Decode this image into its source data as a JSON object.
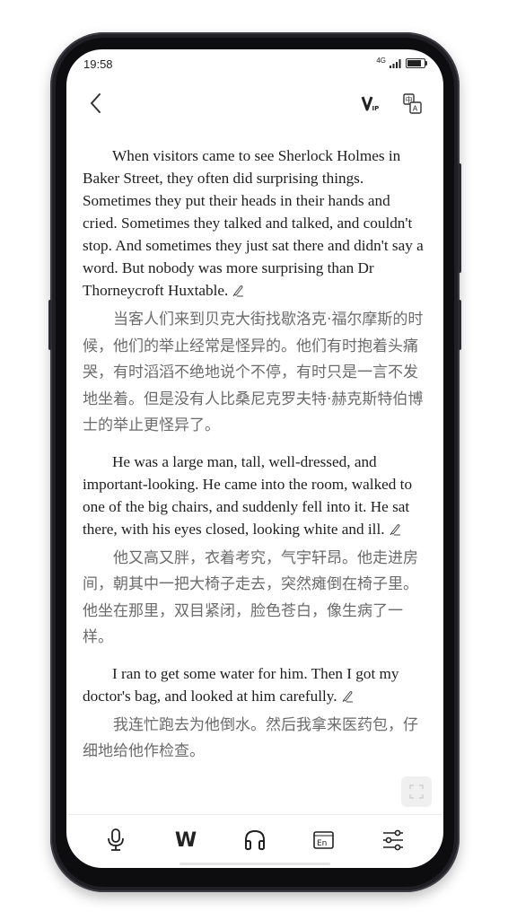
{
  "status_bar": {
    "time": "19:58",
    "network": "4G",
    "icons": [
      "signal-icon",
      "battery-icon"
    ]
  },
  "header": {
    "icons": [
      "back-chevron-icon",
      "vip-icon",
      "translate-icon"
    ]
  },
  "reader": {
    "blocks": [
      {
        "en": "When visitors came to see Sherlock Holmes in Baker Street, they often did surprising things. Sometimes they put their heads in their hands and cried. Sometimes they talked and talked, and couldn't stop. And sometimes they just sat there and didn't say a word. But nobody was more surprising than Dr Thorneycroft Huxtable.",
        "zh": "当客人们来到贝克大街找歇洛克·福尔摩斯的时候，他们的举止经常是怪异的。他们有时抱着头痛哭，有时滔滔不绝地说个不停，有时只是一言不发地坐着。但是没有人比桑尼克罗夫特·赫克斯特伯博士的举止更怪异了。"
      },
      {
        "en": "He was a large man, tall, well-dressed, and important-looking. He came into the room, walked to one of the big chairs, and suddenly fell into it. He sat there, with his eyes closed, looking white and ill.",
        "zh": "他又高又胖，衣着考究，气宇轩昂。他走进房间，朝其中一把大椅子走去，突然瘫倒在椅子里。他坐在那里，双目紧闭，脸色苍白，像生病了一样。"
      },
      {
        "en": "I ran to get some water for him. Then I got my doctor's bag, and looked at him carefully.",
        "zh": "我连忙跑去为他倒水。然后我拿来医药包，仔细地给他作检查。"
      }
    ]
  },
  "toolbar": {
    "word_label": "W",
    "english_label": "En",
    "icons": [
      "microphone-icon",
      "word-icon",
      "headphones-icon",
      "english-icon",
      "settings-sliders-icon"
    ]
  }
}
